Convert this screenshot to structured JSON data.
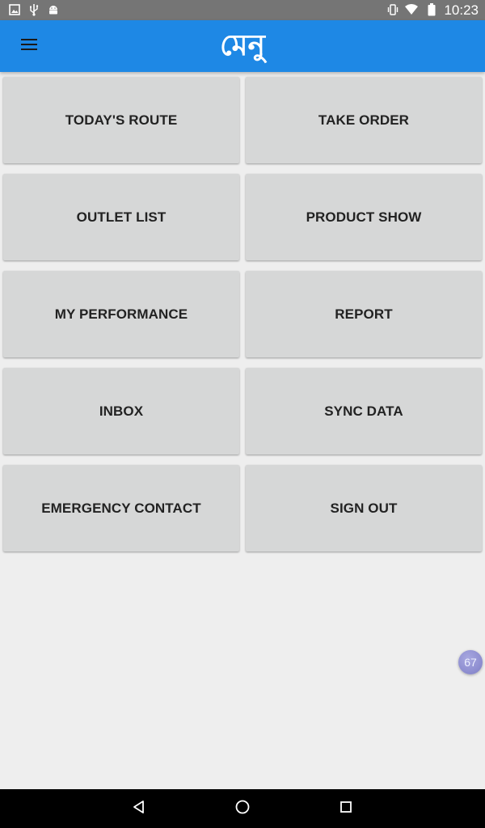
{
  "status_bar": {
    "time": "10:23",
    "left_icons": [
      "image-icon",
      "usb-icon",
      "android-icon"
    ],
    "right_icons": [
      "vibrate-icon",
      "wifi-icon",
      "battery-icon"
    ]
  },
  "app_bar": {
    "title": "মেনু",
    "menu_icon": "hamburger-menu-icon",
    "color": "#1e88e5"
  },
  "menu_items": [
    {
      "label": "TODAY'S ROUTE"
    },
    {
      "label": "TAKE ORDER"
    },
    {
      "label": "OUTLET LIST"
    },
    {
      "label": "PRODUCT SHOW"
    },
    {
      "label": "MY PERFORMANCE"
    },
    {
      "label": "REPORT"
    },
    {
      "label": "INBOX"
    },
    {
      "label": "SYNC DATA"
    },
    {
      "label": "EMERGENCY CONTACT"
    },
    {
      "label": "SIGN OUT"
    }
  ],
  "floating_badge": {
    "value": "67"
  },
  "nav_bar": {
    "buttons": [
      "back-icon",
      "home-icon",
      "recents-icon"
    ]
  }
}
